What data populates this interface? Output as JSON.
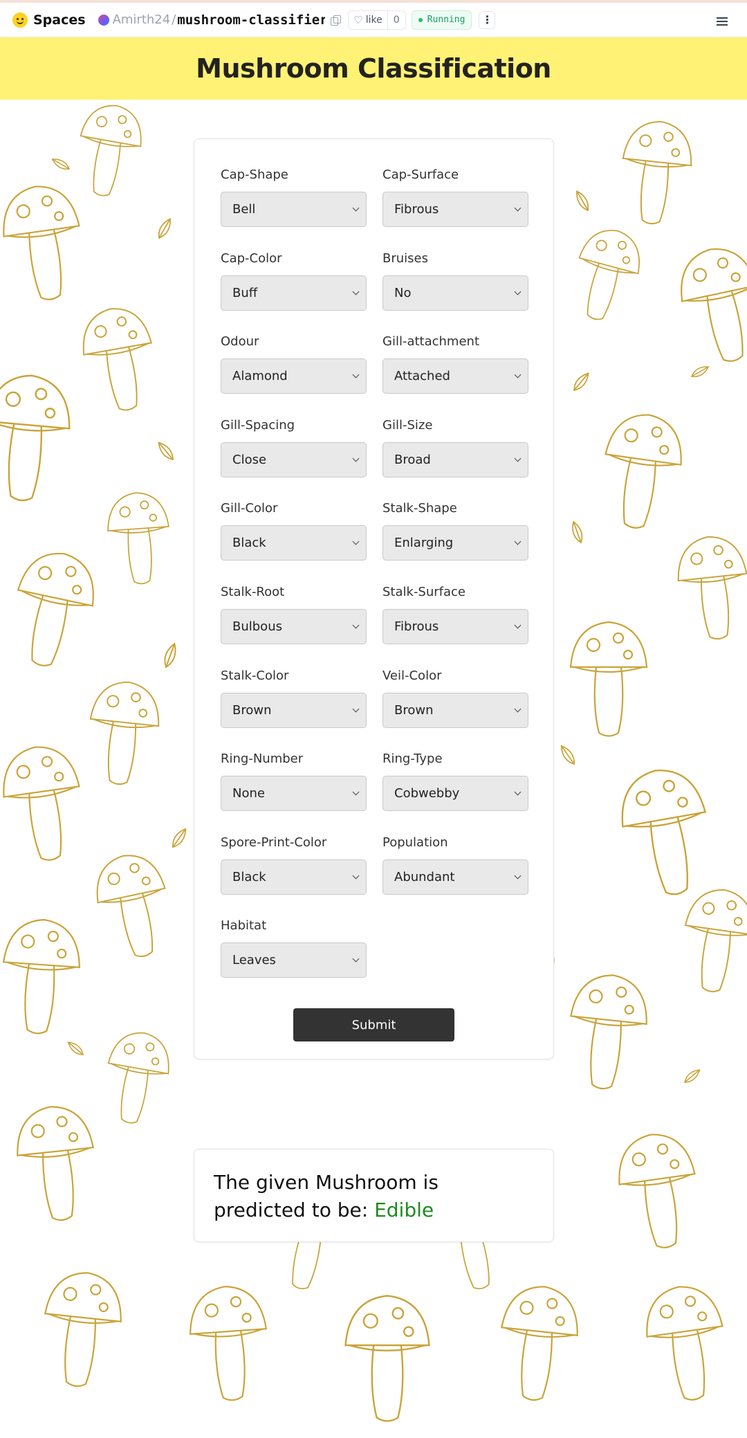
{
  "topbar": {
    "brand": "Spaces",
    "owner": "Amirth24",
    "separator": "/",
    "repo": "mushroom-classifier",
    "like_label": "like",
    "like_count": "0",
    "status": "Running",
    "kebab": "⋮"
  },
  "header": {
    "title": "Mushroom Classification"
  },
  "form": {
    "fields": [
      {
        "label": "Cap-Shape",
        "value": "Bell"
      },
      {
        "label": "Cap-Surface",
        "value": "Fibrous"
      },
      {
        "label": "Cap-Color",
        "value": "Buff"
      },
      {
        "label": "Bruises",
        "value": "No"
      },
      {
        "label": "Odour",
        "value": "Alamond"
      },
      {
        "label": "Gill-attachment",
        "value": "Attached"
      },
      {
        "label": "Gill-Spacing",
        "value": "Close"
      },
      {
        "label": "Gill-Size",
        "value": "Broad"
      },
      {
        "label": "Gill-Color",
        "value": "Black"
      },
      {
        "label": "Stalk-Shape",
        "value": "Enlarging"
      },
      {
        "label": "Stalk-Root",
        "value": "Bulbous"
      },
      {
        "label": "Stalk-Surface",
        "value": "Fibrous"
      },
      {
        "label": "Stalk-Color",
        "value": "Brown"
      },
      {
        "label": "Veil-Color",
        "value": "Brown"
      },
      {
        "label": "Ring-Number",
        "value": "None"
      },
      {
        "label": "Ring-Type",
        "value": "Cobwebby"
      },
      {
        "label": "Spore-Print-Color",
        "value": "Black"
      },
      {
        "label": "Population",
        "value": "Abundant"
      },
      {
        "label": "Habitat",
        "value": "Leaves"
      }
    ],
    "submit_label": "Submit"
  },
  "result": {
    "prefix": "The given Mushroom is predicted to be: ",
    "value": "Edible"
  },
  "colors": {
    "header_bg": "#fff274",
    "pattern_stroke": "#c9a43a",
    "result_accent": "#1f8a1f",
    "button_bg": "#333333",
    "status_green": "#16a06a"
  }
}
